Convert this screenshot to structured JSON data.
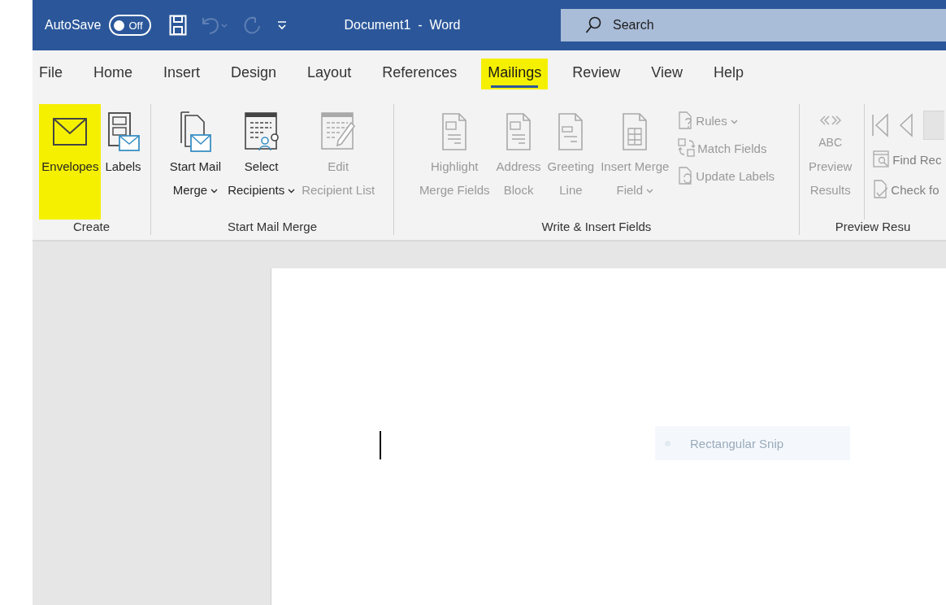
{
  "title_bar": {
    "autosave_label": "AutoSave",
    "autosave_toggle": {
      "label": "Off",
      "on": false
    },
    "undo": {
      "disabled": true
    },
    "redo": {
      "disabled": true
    },
    "document_title": "Document1  -  Word",
    "search": {
      "placeholder": "Search"
    }
  },
  "tabs": [
    {
      "label": "File",
      "selected": false,
      "highlighted": false
    },
    {
      "label": "Home",
      "selected": false,
      "highlighted": false
    },
    {
      "label": "Insert",
      "selected": false,
      "highlighted": false
    },
    {
      "label": "Design",
      "selected": false,
      "highlighted": false
    },
    {
      "label": "Layout",
      "selected": false,
      "highlighted": false
    },
    {
      "label": "References",
      "selected": false,
      "highlighted": false
    },
    {
      "label": "Mailings",
      "selected": true,
      "highlighted": true
    },
    {
      "label": "Review",
      "selected": false,
      "highlighted": false
    },
    {
      "label": "View",
      "selected": false,
      "highlighted": false
    },
    {
      "label": "Help",
      "selected": false,
      "highlighted": false
    }
  ],
  "ribbon_groups": [
    {
      "label": "Create",
      "buttons": [
        {
          "kind": "large",
          "label_lines": [
            "Envelopes"
          ],
          "dropdown": false,
          "disabled": false,
          "highlighted": true
        },
        {
          "kind": "large",
          "label_lines": [
            "Labels"
          ],
          "dropdown": false,
          "disabled": false,
          "highlighted": false
        }
      ]
    },
    {
      "label": "Start Mail Merge",
      "buttons": [
        {
          "kind": "large",
          "label_lines": [
            "Start Mail",
            "Merge"
          ],
          "dropdown": true,
          "disabled": false,
          "highlighted": false
        },
        {
          "kind": "large",
          "label_lines": [
            "Select",
            "Recipients"
          ],
          "dropdown": true,
          "disabled": false,
          "highlighted": false
        },
        {
          "kind": "large",
          "label_lines": [
            "Edit",
            "Recipient List"
          ],
          "dropdown": false,
          "disabled": true,
          "highlighted": false
        }
      ]
    },
    {
      "label": "Write & Insert Fields",
      "buttons": [
        {
          "kind": "large",
          "label_lines": [
            "Highlight",
            "Merge Fields"
          ],
          "dropdown": false,
          "disabled": true,
          "highlighted": false
        },
        {
          "kind": "large",
          "label_lines": [
            "Address",
            "Block"
          ],
          "dropdown": false,
          "disabled": true,
          "highlighted": false
        },
        {
          "kind": "large",
          "label_lines": [
            "Greeting",
            "Line"
          ],
          "dropdown": false,
          "disabled": true,
          "highlighted": false
        },
        {
          "kind": "large",
          "label_lines": [
            "Insert Merge",
            "Field"
          ],
          "dropdown": true,
          "disabled": true,
          "highlighted": false
        },
        {
          "kind": "stack",
          "items": [
            {
              "label": "Rules",
              "dropdown": true,
              "disabled": true
            },
            {
              "label": "Match Fields",
              "dropdown": false,
              "disabled": true
            },
            {
              "label": "Update Labels",
              "dropdown": false,
              "disabled": true
            }
          ]
        }
      ]
    },
    {
      "label": "Preview Resu",
      "buttons": [
        {
          "kind": "large",
          "icon_text": "ABC",
          "label_lines": [
            "Preview",
            "Results"
          ],
          "dropdown": false,
          "disabled": true,
          "highlighted": false
        },
        {
          "kind": "nav",
          "items": [
            {
              "label": "Find Rec",
              "disabled": true
            },
            {
              "label": "Check fo",
              "disabled": true
            }
          ]
        }
      ]
    }
  ],
  "document": {
    "snip_tooltip": "Rectangular Snip"
  }
}
